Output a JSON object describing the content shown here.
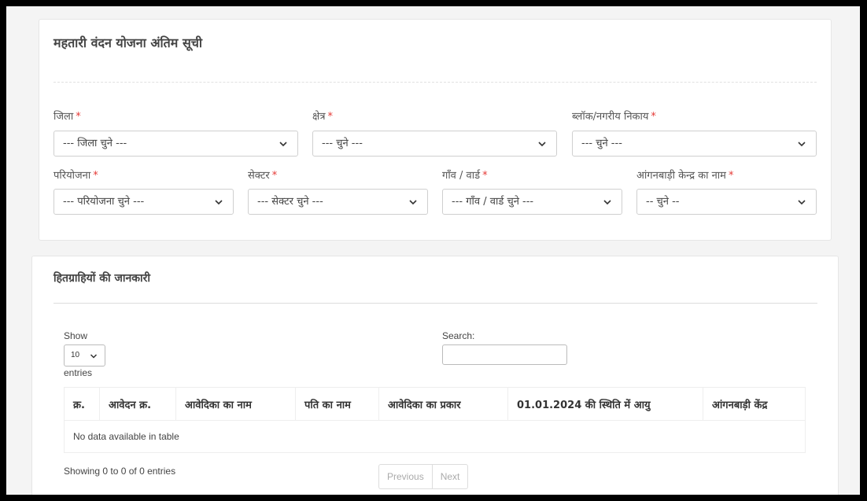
{
  "filter_card": {
    "title": "महतारी वंदन योजना अंतिम सूची",
    "required_mark": "*",
    "fields": [
      {
        "label": "जिला",
        "value": "--- जिला चुने ---"
      },
      {
        "label": "क्षेत्र",
        "value": "--- चुने ---"
      },
      {
        "label": "ब्लॉक/नगरीय निकाय",
        "value": "--- चुने ---"
      },
      {
        "label": "परियोजना",
        "value": "--- परियोजना चुने ---"
      },
      {
        "label": "सेक्टर",
        "value": "--- सेक्टर चुने ---"
      },
      {
        "label": "गाँव / वार्ड",
        "value": "--- गाँव / वार्ड चुने ---"
      },
      {
        "label": "आंगनबाड़ी केन्द्र का नाम",
        "value": "-- चुने --"
      }
    ]
  },
  "beneficiary_card": {
    "title": "हितग्राहियों की जानकारी",
    "show_label": "Show",
    "entries_label": "entries",
    "page_length": "10",
    "search_label": "Search:",
    "columns": [
      "क्र.",
      "आवेदन क्र.",
      "आवेदिका का नाम",
      "पति का नाम",
      "आवेदिका का प्रकार",
      "01.01.2024 की स्थिति में आयु",
      "आंगनबाड़ी केंद्र"
    ],
    "empty_message": "No data available in table",
    "info": "Showing 0 to 0 of 0 entries",
    "previous_label": "Previous",
    "next_label": "Next"
  }
}
